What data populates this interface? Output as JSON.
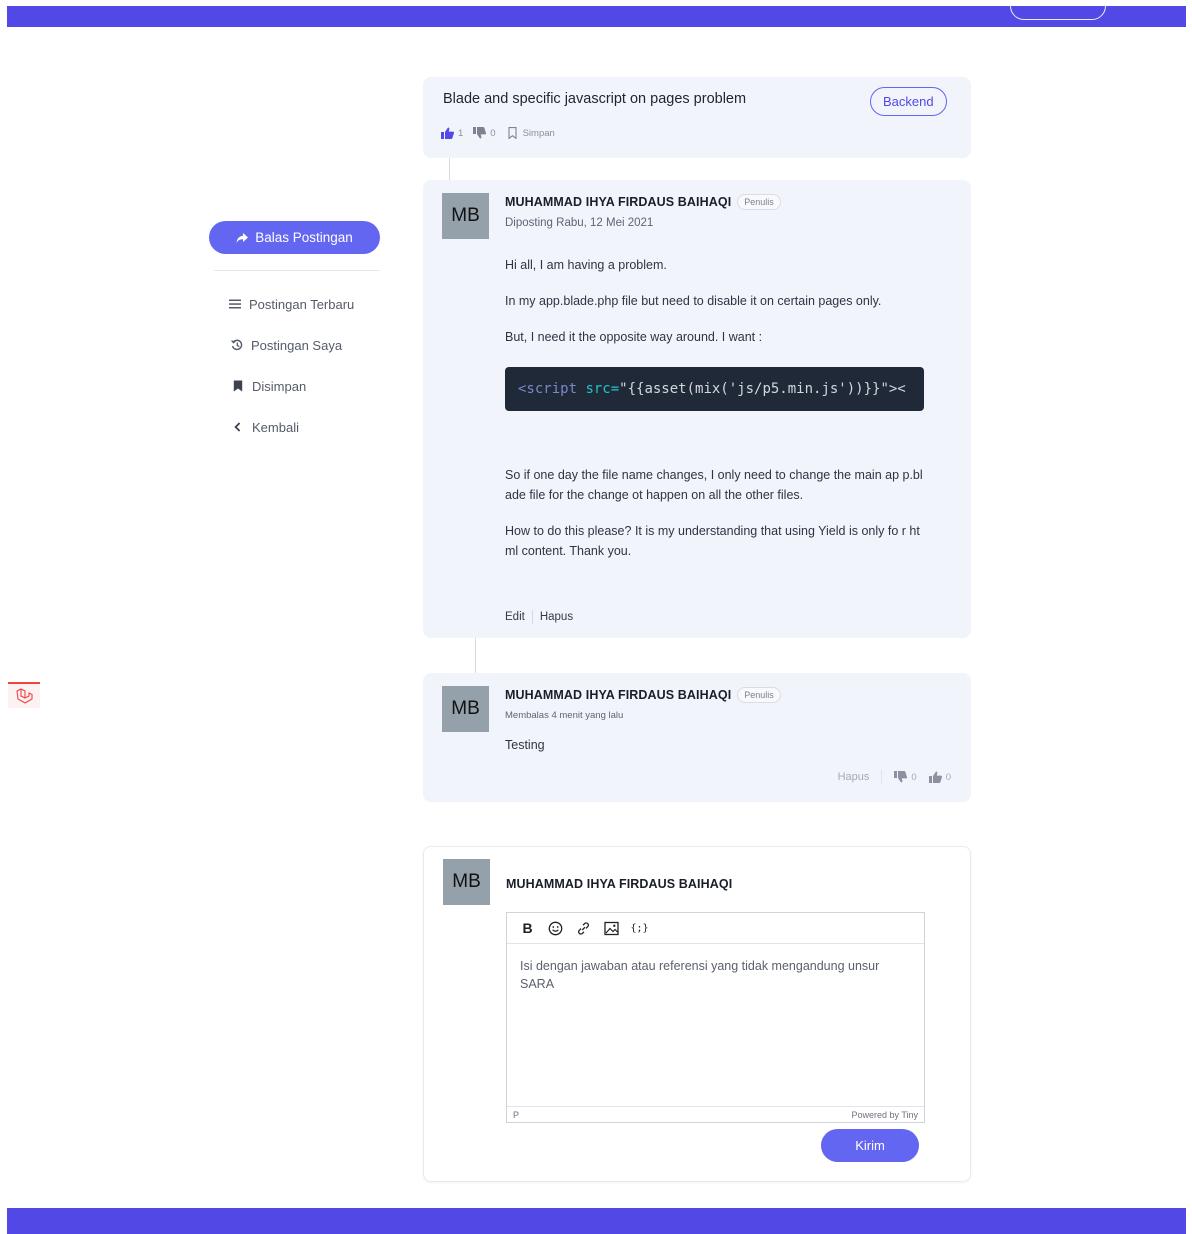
{
  "colors": {
    "primary": "#5148e6",
    "button": "#6366f1",
    "card_bg": "#f2f4fb",
    "code_bg": "#1f2937"
  },
  "sidebar": {
    "reply_button": "Balas Postingan",
    "reply_icon": "share-icon",
    "items": [
      {
        "label": "Postingan Terbaru",
        "icon": "list-icon"
      },
      {
        "label": "Postingan Saya",
        "icon": "history-icon"
      },
      {
        "label": "Disimpan",
        "icon": "bookmark-icon"
      },
      {
        "label": "Kembali",
        "icon": "chevron-left-icon"
      }
    ]
  },
  "post": {
    "title": "Blade and specific javascript on pages problem",
    "tag": "Backend",
    "likes": "1",
    "dislikes": "0",
    "save_label": "Simpan"
  },
  "question": {
    "avatar": "MB",
    "author": "MUHAMMAD IHYA FIRDAUS BAIHAQI",
    "role": "Penulis",
    "date": "Diposting Rabu, 12 Mei 2021",
    "paragraphs": [
      "Hi all, I am having a problem.",
      "In my app.blade.php file but need to disable it on certain pages only.",
      "But, I need it the opposite way around. I want :"
    ],
    "code": {
      "tag_open": "<script ",
      "attr": "src=",
      "value": "\"{{asset(mix('js/p5.min.js'))}}\"><"
    },
    "paragraphs_after": [
      "So if one day the file name changes, I only need to change the main ap p.blade file for the change ot happen on all the other files.",
      "How to do this please? It is my understanding that using Yield is only fo r html content. Thank you."
    ],
    "edit_label": "Edit",
    "delete_label": "Hapus"
  },
  "reply": {
    "avatar": "MB",
    "author": "MUHAMMAD IHYA FIRDAUS BAIHAQI",
    "role": "Penulis",
    "time": "Membalas 4 menit yang lalu",
    "text": "Testing",
    "delete_label": "Hapus",
    "dislikes": "0",
    "likes": "0"
  },
  "composer": {
    "avatar": "MB",
    "author": "MUHAMMAD IHYA FIRDAUS BAIHAQI",
    "toolbar": [
      "B",
      "emoji-icon",
      "link-icon",
      "image-icon",
      "code-icon"
    ],
    "bold_label": "B",
    "code_label": "{;}",
    "placeholder": "Isi dengan jawaban atau referensi yang tidak mengandung unsur SARA",
    "status_left": "P",
    "status_right": "Powered by Tiny",
    "send_label": "Kirim"
  }
}
